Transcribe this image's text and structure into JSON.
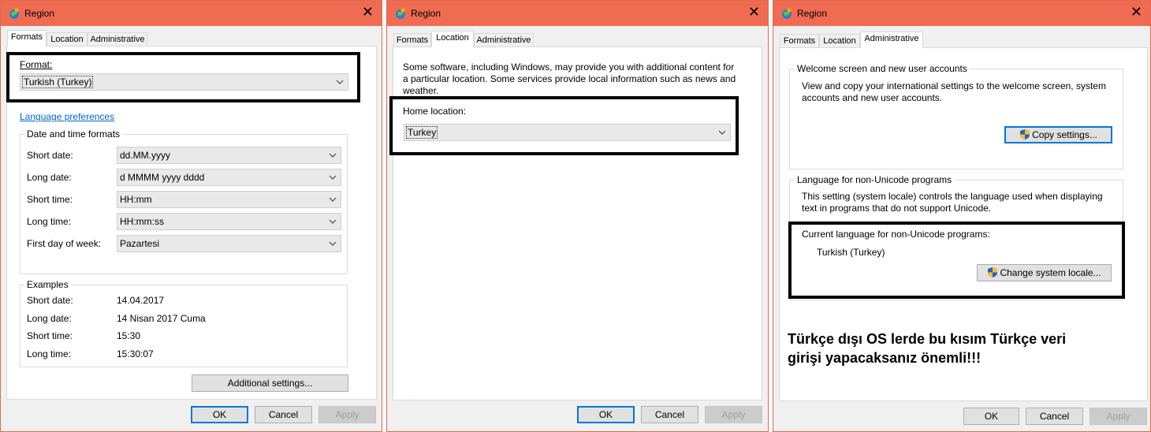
{
  "window_title": "Region",
  "close_symbol": "✕",
  "tabs": {
    "formats": "Formats",
    "location": "Location",
    "administrative": "Administrative"
  },
  "buttons": {
    "ok": "OK",
    "cancel": "Cancel",
    "apply": "Apply"
  },
  "formats": {
    "format_label": "Format:",
    "format_value": "Turkish (Turkey)",
    "language_link": "Language preferences",
    "datetime_group": "Date and time formats",
    "rows": [
      {
        "label": "Short date:",
        "value": "dd.MM.yyyy"
      },
      {
        "label": "Long date:",
        "value": "d MMMM yyyy dddd"
      },
      {
        "label": "Short time:",
        "value": "HH:mm"
      },
      {
        "label": "Long time:",
        "value": "HH:mm:ss"
      },
      {
        "label": "First day of week:",
        "value": "Pazartesi"
      }
    ],
    "examples_group": "Examples",
    "examples": [
      {
        "label": "Short date:",
        "value": "14.04.2017"
      },
      {
        "label": "Long date:",
        "value": "14 Nisan 2017 Cuma"
      },
      {
        "label": "Short time:",
        "value": "15:30"
      },
      {
        "label": "Long time:",
        "value": "15:30:07"
      }
    ],
    "additional_settings": "Additional settings..."
  },
  "location": {
    "description": "Some software, including Windows, may provide you with additional content for a particular location. Some services provide local information such as news and weather.",
    "home_label": "Home location:",
    "home_value": "Turkey"
  },
  "administrative": {
    "welcome_group": "Welcome screen and new user accounts",
    "welcome_text": "View and copy your international settings to the welcome screen, system accounts and new user accounts.",
    "copy_settings": "Copy settings...",
    "nonunicode_group": "Language for non-Unicode programs",
    "nonunicode_text": "This setting (system locale) controls the language used when displaying text in programs that do not support Unicode.",
    "current_label": "Current language for non-Unicode programs:",
    "current_value": "Turkish (Turkey)",
    "change_locale": "Change system locale...",
    "annotation": "Türkçe dışı OS lerde bu kısım Türkçe veri girişi yapacaksanız önemli!!!"
  }
}
